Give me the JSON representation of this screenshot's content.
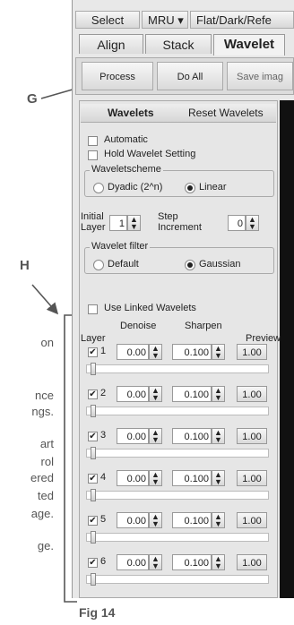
{
  "callouts": {
    "g": "G",
    "h": "H"
  },
  "margin_fragments": [
    "on",
    "nce",
    "ngs.",
    "art",
    "rol",
    "ered",
    "ted",
    "age.",
    "ge."
  ],
  "menu": [
    "Select",
    "MRU ▾",
    "Flat/Dark/Refe"
  ],
  "tabs": [
    "Align",
    "Stack",
    "Wavelet"
  ],
  "toolbar": {
    "process": "Process",
    "do_all": "Do All",
    "save": "Save imag"
  },
  "panel": {
    "title": "Wavelets",
    "reset": "Reset Wavelets",
    "automatic": "Automatic",
    "hold": "Hold Wavelet Setting",
    "scheme_label": "Waveletscheme",
    "dyadic": "Dyadic (2^n)",
    "linear": "Linear",
    "initial_layer_line1": "Initial",
    "initial_layer_line2": "Layer",
    "initial_layer_value": "1",
    "step_line1": "Step",
    "step_line2": "Increment",
    "step_value": "0",
    "filter_label": "Wavelet filter",
    "default": "Default",
    "gaussian": "Gaussian",
    "use_linked": "Use Linked Wavelets",
    "col_layer": "Layer",
    "col_denoise": "Denoise",
    "col_sharpen": "Sharpen",
    "col_preview": "Preview",
    "layers": [
      {
        "n": "1",
        "denoise": "0.00",
        "sharpen": "0.100",
        "preview": "1.00"
      },
      {
        "n": "2",
        "denoise": "0.00",
        "sharpen": "0.100",
        "preview": "1.00"
      },
      {
        "n": "3",
        "denoise": "0.00",
        "sharpen": "0.100",
        "preview": "1.00"
      },
      {
        "n": "4",
        "denoise": "0.00",
        "sharpen": "0.100",
        "preview": "1.00"
      },
      {
        "n": "5",
        "denoise": "0.00",
        "sharpen": "0.100",
        "preview": "1.00"
      },
      {
        "n": "6",
        "denoise": "0.00",
        "sharpen": "0.100",
        "preview": "1.00"
      }
    ]
  },
  "figure_caption": "Fig 14"
}
